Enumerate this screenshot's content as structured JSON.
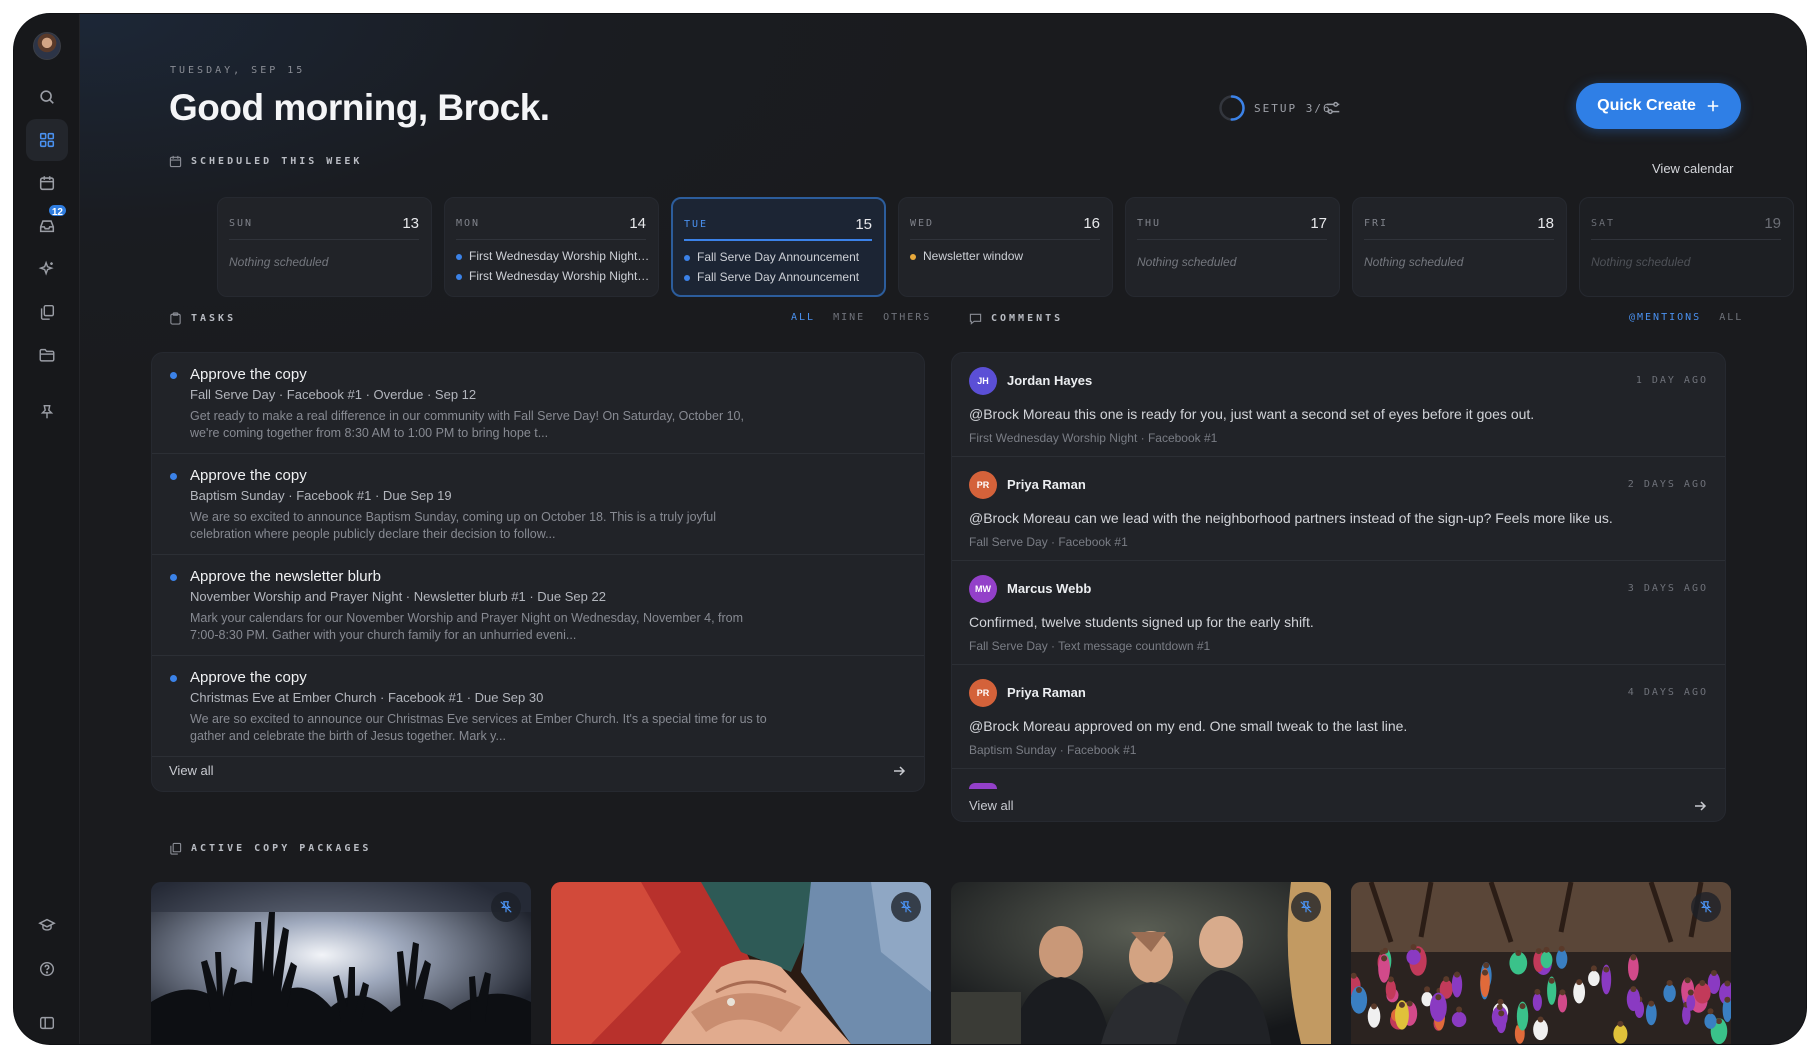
{
  "sidebar": {
    "inbox_badge": "12",
    "items": [
      {
        "name": "search",
        "icon": "search-icon"
      },
      {
        "name": "dashboard",
        "icon": "dashboard-grid-icon",
        "active": true
      },
      {
        "name": "calendar",
        "icon": "calendar-icon"
      },
      {
        "name": "inbox",
        "icon": "inbox-icon"
      },
      {
        "name": "ai",
        "icon": "sparkles-icon"
      },
      {
        "name": "copies",
        "icon": "copy-stack-icon"
      },
      {
        "name": "folders",
        "icon": "folder-icon"
      },
      {
        "name": "pins",
        "icon": "pin-icon"
      },
      {
        "name": "learn",
        "icon": "graduation-cap-icon"
      },
      {
        "name": "help",
        "icon": "help-circle-icon"
      },
      {
        "name": "collapse",
        "icon": "sidebar-toggle-icon"
      }
    ]
  },
  "header": {
    "date": "TUESDAY, SEP 15",
    "greeting": "Good morning, Brock.",
    "setup_label": "SETUP 3/6",
    "setup_progress": 0.5,
    "quick_create": "Quick Create",
    "accent": "#2f7fe6"
  },
  "week": {
    "label": "SCHEDULED THIS WEEK",
    "view_calendar": "View calendar",
    "days": [
      {
        "name": "SUN",
        "num": "13",
        "empty": "Nothing scheduled",
        "events": []
      },
      {
        "name": "MON",
        "num": "14",
        "events": [
          {
            "text": "First Wednesday Worship Night ...",
            "color": "#3b82e8"
          },
          {
            "text": "First Wednesday Worship Night ...",
            "color": "#3b82e8"
          }
        ]
      },
      {
        "name": "TUE",
        "num": "15",
        "today": true,
        "events": [
          {
            "text": "Fall Serve Day Announcement",
            "color": "#3b82e8"
          },
          {
            "text": "Fall Serve Day Announcement",
            "color": "#3b82e8"
          }
        ]
      },
      {
        "name": "WED",
        "num": "16",
        "events": [
          {
            "text": "Newsletter window",
            "color": "#e8a93b"
          }
        ]
      },
      {
        "name": "THU",
        "num": "17",
        "empty": "Nothing scheduled",
        "events": []
      },
      {
        "name": "FRI",
        "num": "18",
        "empty": "Nothing scheduled",
        "events": []
      },
      {
        "name": "SAT",
        "num": "19",
        "empty": "Nothing scheduled",
        "events": []
      }
    ]
  },
  "tasks": {
    "label": "TASKS",
    "filters": [
      "ALL",
      "MINE",
      "OTHERS"
    ],
    "view_all": "View all",
    "items": [
      {
        "title": "Approve the copy",
        "meta": "Fall Serve Day · Facebook #1 · Overdue · Sep 12",
        "body1": "Get ready to make a real difference in our community with Fall Serve Day! On Saturday, October 10,",
        "body2": "we're coming together from 8:30 AM to 1:00 PM to bring hope t..."
      },
      {
        "title": "Approve the copy",
        "meta": "Baptism Sunday · Facebook #1 · Due Sep 19",
        "body1": "We are so excited to announce Baptism Sunday, coming up on October 18. This is a truly joyful",
        "body2": "celebration where people publicly declare their decision to follow..."
      },
      {
        "title": "Approve the newsletter blurb",
        "meta": "November Worship and Prayer Night · Newsletter blurb #1 · Due Sep 22",
        "body1": "Mark your calendars for our November Worship and Prayer Night on Wednesday, November 4, from",
        "body2": "7:00-8:30 PM. Gather with your church family for an unhurried eveni..."
      },
      {
        "title": "Approve the copy",
        "meta": "Christmas Eve at Ember Church · Facebook #1 · Due Sep 30",
        "body1": "We are so excited to announce our Christmas Eve services at Ember Church. It's a special time for us to",
        "body2": "gather and celebrate the birth of Jesus together. Mark y..."
      }
    ]
  },
  "comments": {
    "label": "COMMENTS",
    "filters": [
      "@MENTIONS",
      "ALL"
    ],
    "view_all": "View all",
    "items": [
      {
        "initials": "JH",
        "name": "Jordan Hayes",
        "time": "1 DAY AGO",
        "color": "#5b4fd6",
        "text": "@Brock Moreau this one is ready for you, just want a second set of eyes before it goes out.",
        "context": "First Wednesday Worship Night · Facebook #1"
      },
      {
        "initials": "PR",
        "name": "Priya Raman",
        "time": "2 DAYS AGO",
        "color": "#d4623a",
        "text": "@Brock Moreau can we lead with the neighborhood partners instead of the sign-up? Feels more like us.",
        "context": "Fall Serve Day · Facebook #1"
      },
      {
        "initials": "MW",
        "name": "Marcus Webb",
        "time": "3 DAYS AGO",
        "color": "#9340c9",
        "text": "Confirmed, twelve students signed up for the early shift.",
        "context": "Fall Serve Day · Text message countdown #1"
      },
      {
        "initials": "PR",
        "name": "Priya Raman",
        "time": "4 DAYS AGO",
        "color": "#d4623a",
        "text": "@Brock Moreau approved on my end. One small tweak to the last line.",
        "context": "Baptism Sunday · Facebook #1"
      }
    ]
  },
  "packages": {
    "label": "ACTIVE COPY PACKAGES",
    "items": [
      {
        "scene": "concert-hands-photo",
        "icon": "unpin-icon"
      },
      {
        "scene": "stacked-hands-photo",
        "icon": "unpin-icon"
      },
      {
        "scene": "group-prayer-photo",
        "icon": "unpin-icon"
      },
      {
        "scene": "outdoor-festival-crowd-photo",
        "icon": "unpin-icon"
      }
    ]
  }
}
